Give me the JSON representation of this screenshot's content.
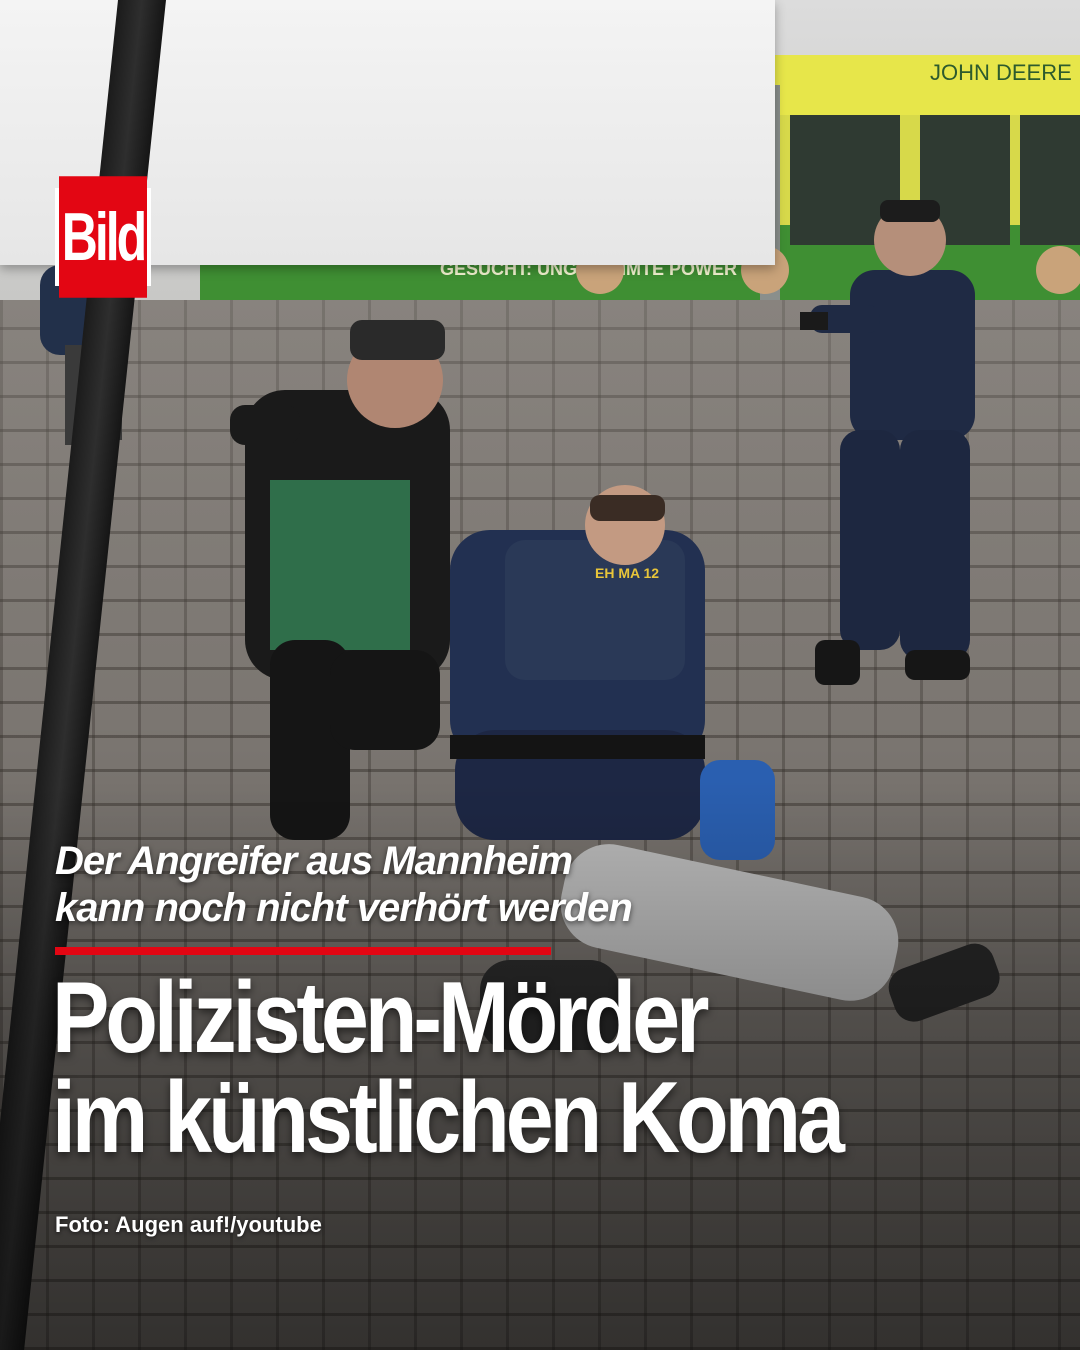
{
  "brand": {
    "logo_text": "Bild",
    "logo_color": "#e30613"
  },
  "article": {
    "kicker_line1": "Der Angreifer aus Mannheim",
    "kicker_line2": "kann noch nicht verhört werden",
    "headline_line1": "Polizisten-Mörder",
    "headline_line2": "im künstlichen Koma",
    "photo_credit": "Foto: Augen auf!/youtube",
    "accent_color": "#e30613"
  },
  "photo": {
    "tram_ad_text": "GESUCHT: UNGEZÄHMTE POWER",
    "tram_brand_text": "JOHN DEERE"
  }
}
